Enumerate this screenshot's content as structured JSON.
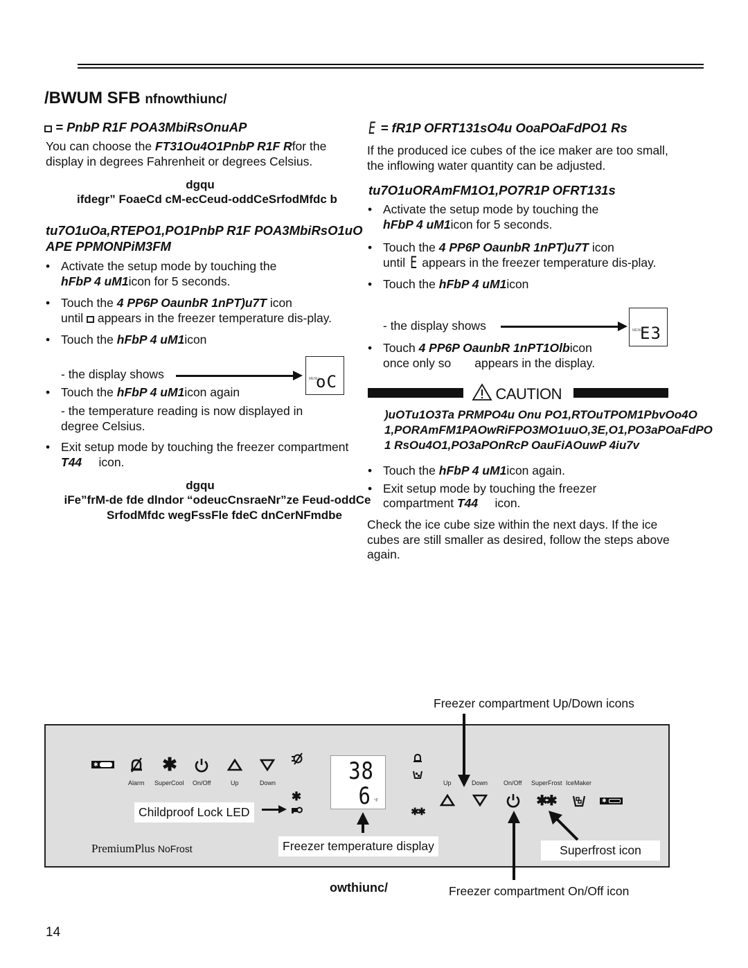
{
  "header": {
    "title_main": "/BWUM SFB",
    "title_tail": "nfnowthiunc/"
  },
  "left": {
    "section_symbol": "box-symbol",
    "section_heading": "= PnbP R1F POA3MbiRsOnuAP",
    "intro_prefix": "You can choose the ",
    "intro_bold": "FT31Ou4O1PnbP R1F R",
    "intro_suffix": "for the display in degrees Fahrenheit or degrees Celsius.",
    "note1_heading": "dgqu",
    "note1_text": "ifdegr” FoaeCd  cM-ecCeud-oddCeSrfodMfdc b",
    "proc_heading_line1": "tu7O1uOa,RTEPO1,PO1PnbP R1F POA3MbiRsO1uO",
    "proc_heading_line2": "APE PPMONPiM3FM",
    "steps": [
      {
        "prefix": "Activate the setup mode by touching the ",
        "bold": "hFbP 4 uM1",
        "suffix": "icon for 5 seconds."
      },
      {
        "prefix": "Touch the ",
        "bold": "4 PP6P OaunbR 1nPT)u7T",
        "suffix": " icon",
        "line2_prefix": "until ",
        "line2_suffix": " appears in the freezer temperature dis-play."
      },
      {
        "prefix": "Touch the ",
        "bold": "hFbP 4 uM1",
        "suffix": "icon"
      },
      {
        "prefix": "Touch the ",
        "bold": "hFbP 4 uM1",
        "suffix": "icon again"
      },
      {
        "prefix": "Exit setup mode by touching the freezer compartment ",
        "bold": "T44",
        "suffix": "     icon."
      }
    ],
    "display_shows": "- the display shows",
    "display_menu": "MENU",
    "display_value": "oC",
    "celsius_note": "- the temperature reading is now displayed in degree Celsius.",
    "note2_heading": "dgqu",
    "note2_line1": "iFe”frM-de fde dlndor “odeucCnsraeNr”ze Feud-oddCe",
    "note2_line2": "SrfodMfdc wegFssFle fdeC dnCerNFmdbe"
  },
  "right": {
    "section_symbol": "E",
    "section_heading": "= fR1P OFRT131sO4u OoaPOaFdPO1 Rs",
    "intro": "If the produced ice cubes of the ice maker are too small, the inflowing water quantity can be adjusted.",
    "proc_heading": "tu7O1uORAmFM1O1,PO7R1P OFRT131s",
    "steps": [
      {
        "prefix": "Activate the setup mode by touching the ",
        "bold": "hFbP 4 uM1",
        "suffix": "icon for 5 seconds."
      },
      {
        "prefix": "Touch the ",
        "bold": "4 PP6P OaunbR 1nPT)u7T",
        "suffix": " icon",
        "line2_prefix": "until ",
        "line2_suffix": " appears in the freezer temperature dis-play."
      },
      {
        "prefix": "Touch the ",
        "bold": "hFbP 4 uM1",
        "suffix": "icon"
      },
      {
        "prefix": "Touch ",
        "bold": "4 PP6P OaunbR 1nPT1Olb",
        "suffix": "icon once only so       appears in the display."
      },
      {
        "prefix": "Touch the ",
        "bold": "hFbP 4 uM1",
        "suffix": "icon again."
      },
      {
        "prefix": "Exit setup mode by touching the freezer compartment ",
        "bold": "T44",
        "suffix": "     icon."
      }
    ],
    "display_shows": "- the display shows",
    "display_menu": "MENU",
    "display_value": "E3",
    "caution_label": "CAUTION",
    "caution_lines": [
      ")uOTu1O3Ta PRMPO4u Onu PO1,RTOuTPOM1PbvOo4O",
      "1,PORAmFM1PAOwRiFPO3MO1uuO,3E,O1,PO3aPOaFdPO",
      "1 RsOu4O1,PO3aPOnRcP OauFiAOuwP 4iu7v"
    ],
    "outro": "Check the ice cube size within the next days. If the ice cubes are still smaller as desired, follow the steps above again."
  },
  "panel": {
    "left_labels": [
      "Alarm",
      "SuperCool",
      "On/Off",
      "Up",
      "Down"
    ],
    "right_labels": [
      "Up",
      "Down",
      "On/Off",
      "SuperFrost",
      "IceMaker"
    ],
    "temp_top": "38",
    "temp_bottom": "6",
    "temp_unit": "°F",
    "brand": "PremiumPlus",
    "brand_sub": "NoFrost"
  },
  "callouts": {
    "updown": "Freezer compartment Up/Down icons",
    "lock": "Childproof Lock LED",
    "temp_display": "Freezer temperature display",
    "superfrost": "Superfrost icon",
    "onoff": "Freezer compartment On/Off icon"
  },
  "figure_caption": "owthiunc/",
  "page_number": "14"
}
